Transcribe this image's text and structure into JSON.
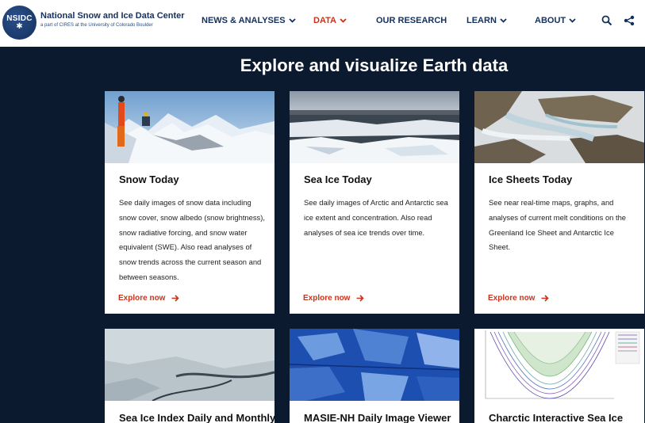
{
  "header": {
    "logo_text": "NSIDC",
    "brand_name": "National Snow and Ice Data Center",
    "brand_sub": "a part of CIRES at the University of Colorado Boulder",
    "nav": [
      {
        "label": "NEWS & ANALYSES",
        "has_dropdown": true
      },
      {
        "label": "DATA",
        "has_dropdown": true,
        "active": true
      },
      {
        "label": "OUR RESEARCH",
        "has_dropdown": false
      },
      {
        "label": "LEARN",
        "has_dropdown": true
      },
      {
        "label": "ABOUT",
        "has_dropdown": true
      }
    ],
    "icons": [
      "search-icon",
      "share-icon"
    ]
  },
  "main": {
    "title": "Explore and visualize Earth data",
    "cards": [
      {
        "title": "Snow Today",
        "description": "See daily images of snow data including snow cover, snow albedo (snow brightness), snow radiative forcing, and snow water equivalent (SWE). Also read analyses of snow trends across the current season and between seasons.",
        "link": "Explore now"
      },
      {
        "title": "Sea Ice Today",
        "description": "See daily images of Arctic and Antarctic sea ice extent and concentration. Also read analyses of sea ice trends over time.",
        "link": "Explore now"
      },
      {
        "title": "Ice Sheets Today",
        "description": "See near real-time maps, graphs, and analyses of current melt conditions on the Greenland Ice Sheet and Antarctic Ice Sheet.",
        "link": "Explore now"
      },
      {
        "title": "Sea Ice Index Daily and Monthly"
      },
      {
        "title": "MASIE-NH Daily Image Viewer"
      },
      {
        "title": "Charctic Interactive Sea Ice"
      }
    ]
  },
  "colors": {
    "page_background": "#0b1a2e",
    "brand_navy": "#14305c",
    "accent_red": "#c8341b"
  }
}
